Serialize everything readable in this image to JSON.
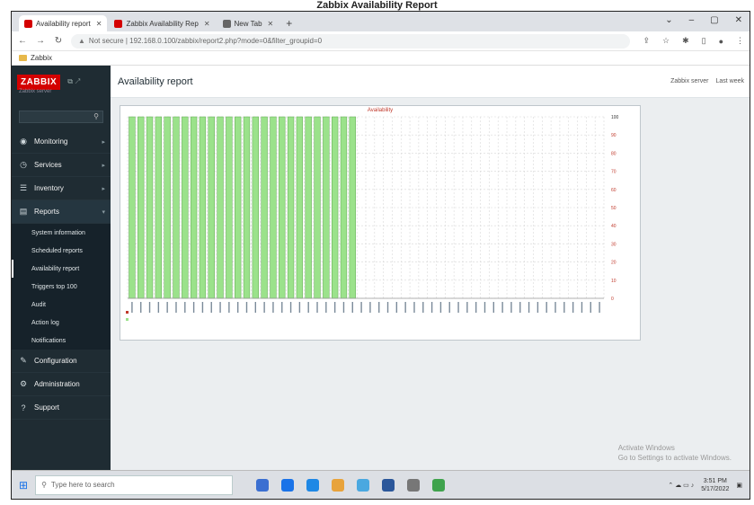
{
  "caption": "Zabbix Availability Report",
  "browser": {
    "tabs": [
      {
        "label": "Availability report",
        "color": "#d40000",
        "active": true
      },
      {
        "label": "Zabbix Availability Rep",
        "color": "#d40000",
        "active": false
      },
      {
        "label": "New Tab",
        "color": "#666666",
        "active": false
      }
    ],
    "new_tab": "+",
    "window_controls": [
      "⌄",
      "–",
      "▢",
      "✕"
    ],
    "url": "Not secure | 192.168.0.100/zabbix/report2.php?mode=0&filter_groupid=0",
    "bookmark": "Zabbix"
  },
  "sidebar": {
    "logo": "ZABBIX",
    "server_name": "Zabbix server",
    "search_placeholder": "",
    "menu": [
      {
        "label": "Monitoring",
        "icon": "eye-icon",
        "glyph": "◉",
        "open": false
      },
      {
        "label": "Services",
        "icon": "clock-icon",
        "glyph": "◷",
        "open": false
      },
      {
        "label": "Inventory",
        "icon": "list-icon",
        "glyph": "☰",
        "open": false
      },
      {
        "label": "Reports",
        "icon": "report-icon",
        "glyph": "▤",
        "open": true
      }
    ],
    "submenu": [
      {
        "label": "System information",
        "selected": false
      },
      {
        "label": "Scheduled reports",
        "selected": false
      },
      {
        "label": "Availability report",
        "selected": true
      },
      {
        "label": "Triggers top 100",
        "selected": false
      },
      {
        "label": "Audit",
        "selected": false
      },
      {
        "label": "Action log",
        "selected": false
      },
      {
        "label": "Notifications",
        "selected": false
      }
    ],
    "bottom_menu": [
      {
        "label": "Configuration",
        "icon": "wrench-icon",
        "glyph": "✎"
      },
      {
        "label": "Administration",
        "icon": "gear-icon",
        "glyph": "⚙"
      },
      {
        "label": "Support",
        "icon": "help-icon",
        "glyph": "?"
      }
    ]
  },
  "header": {
    "title": "Availability report",
    "links": [
      "Zabbix server",
      "Last week"
    ]
  },
  "chart_data": {
    "type": "bar",
    "title": "Availability",
    "series": [
      {
        "name": "",
        "color": "#9be28b",
        "values": [
          100,
          100,
          100,
          100,
          100,
          100,
          100,
          100,
          100,
          100,
          100,
          100,
          100,
          100,
          100,
          100,
          100,
          100,
          100,
          100,
          100,
          100,
          100,
          100,
          100,
          100,
          0,
          0,
          0,
          0,
          0,
          0,
          0,
          0,
          0,
          0,
          0,
          0,
          0,
          0,
          0,
          0,
          0,
          0,
          0,
          0,
          0,
          0,
          0,
          0,
          0,
          0,
          0,
          0
        ]
      }
    ],
    "ylim": [
      0,
      100
    ],
    "yticks": [
      "100",
      "90",
      "80",
      "70",
      "60",
      "50",
      "40",
      "30",
      "20",
      "10",
      "0"
    ],
    "legend": [
      "",
      ""
    ]
  },
  "footer": {
    "copyright": "",
    "activate_line1": "Activate Windows",
    "activate_line2": "Go to Settings to activate Windows."
  },
  "taskbar": {
    "search_placeholder": "Type here to search",
    "time": "3:51 PM",
    "date": "5/17/2022",
    "pinned": [
      "#3b6fd1",
      "#1a73e8",
      "#1e88e5",
      "#e8a33b",
      "#4aa8e0",
      "#2b579a",
      "#777777",
      "#3fa34d"
    ]
  }
}
